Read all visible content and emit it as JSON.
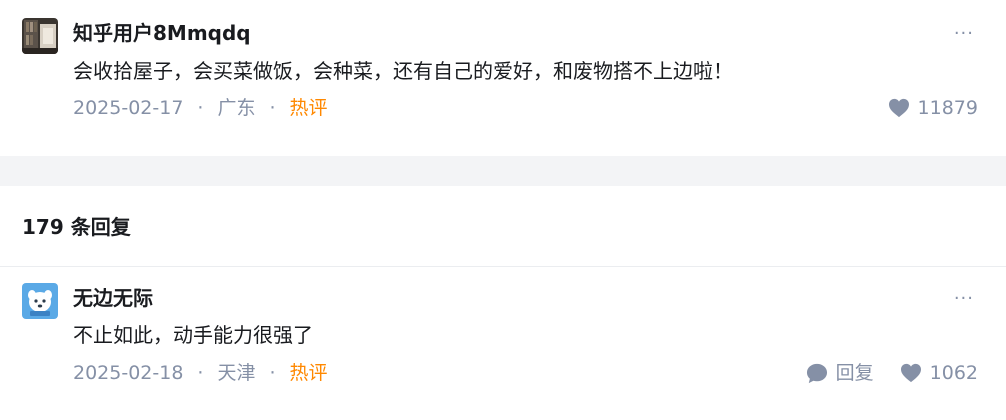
{
  "comment1": {
    "username": "知乎用户8Mmqdq",
    "content": "会收拾屋子，会买菜做饭，会种菜，还有自己的爱好，和废物搭不上边啦！",
    "date": "2025-02-17",
    "sep1": "·",
    "location": "广东",
    "sep2": "·",
    "badge": "热评",
    "likes": "11879",
    "more": "···"
  },
  "replies_header": {
    "count_label": "179 条回复"
  },
  "comment2": {
    "username": "无边无际",
    "content": "不止如此，动手能力很强了",
    "date": "2025-02-18",
    "sep1": "·",
    "location": "天津",
    "sep2": "·",
    "badge": "热评",
    "reply_label": "回复",
    "likes": "1062",
    "more": "···"
  },
  "colors": {
    "meta_gray": "#8590a6",
    "hot_orange": "#ff8800",
    "band": "#f3f4f6"
  },
  "icons": {
    "like": "heart-icon",
    "reply": "comment-bubble-icon",
    "more": "more-dots-icon"
  }
}
